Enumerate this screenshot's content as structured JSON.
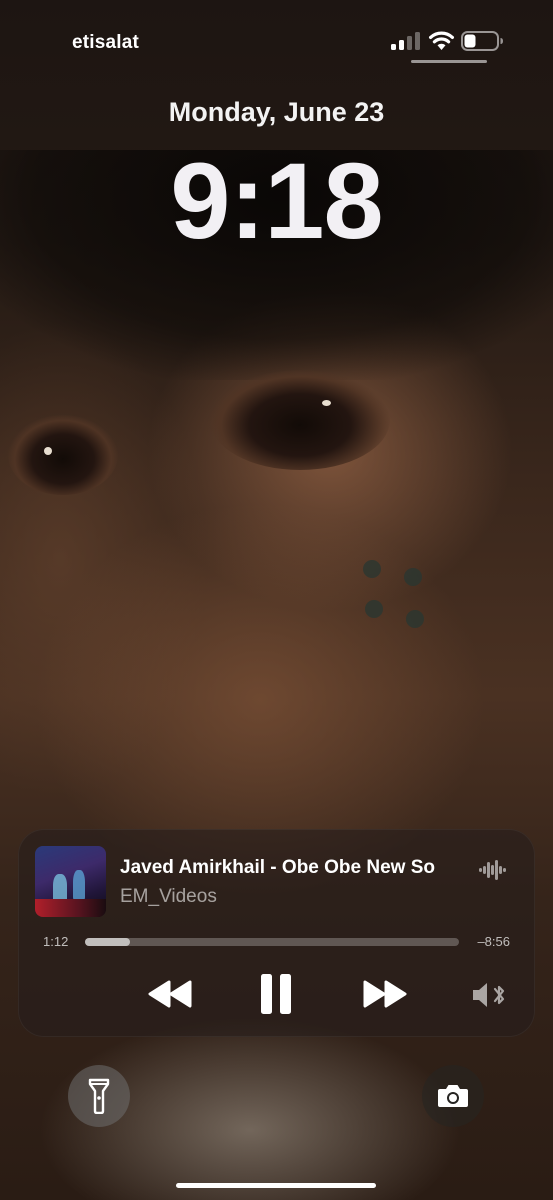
{
  "status_bar": {
    "carrier": "etisalat",
    "signal_bars": 2,
    "signal_icon": "cellular-signal-icon",
    "wifi_icon": "wifi-icon",
    "battery_icon": "battery-icon",
    "battery_level": 0.35
  },
  "lock_screen": {
    "date": "Monday, June 23",
    "time": "9:18"
  },
  "now_playing": {
    "title": "Javed Amirkhail - Obe Obe New So",
    "artist": "EM_Videos",
    "elapsed": "1:12",
    "remaining": "–8:56",
    "progress": 0.12,
    "artwork_icon": "album-artwork",
    "audio_icon": "waveform-icon",
    "controls": {
      "rewind_icon": "rewind-icon",
      "pause_icon": "pause-icon",
      "forward_icon": "fast-forward-icon",
      "output_icon": "bluetooth-speaker-icon"
    }
  },
  "quick_actions": {
    "left_icon": "flashlight-icon",
    "right_icon": "camera-icon"
  },
  "colors": {
    "text": "#ffffff",
    "player_bg": "rgba(38,30,28,0.58)",
    "progress_fill": "rgba(255,255,255,0.62)"
  }
}
